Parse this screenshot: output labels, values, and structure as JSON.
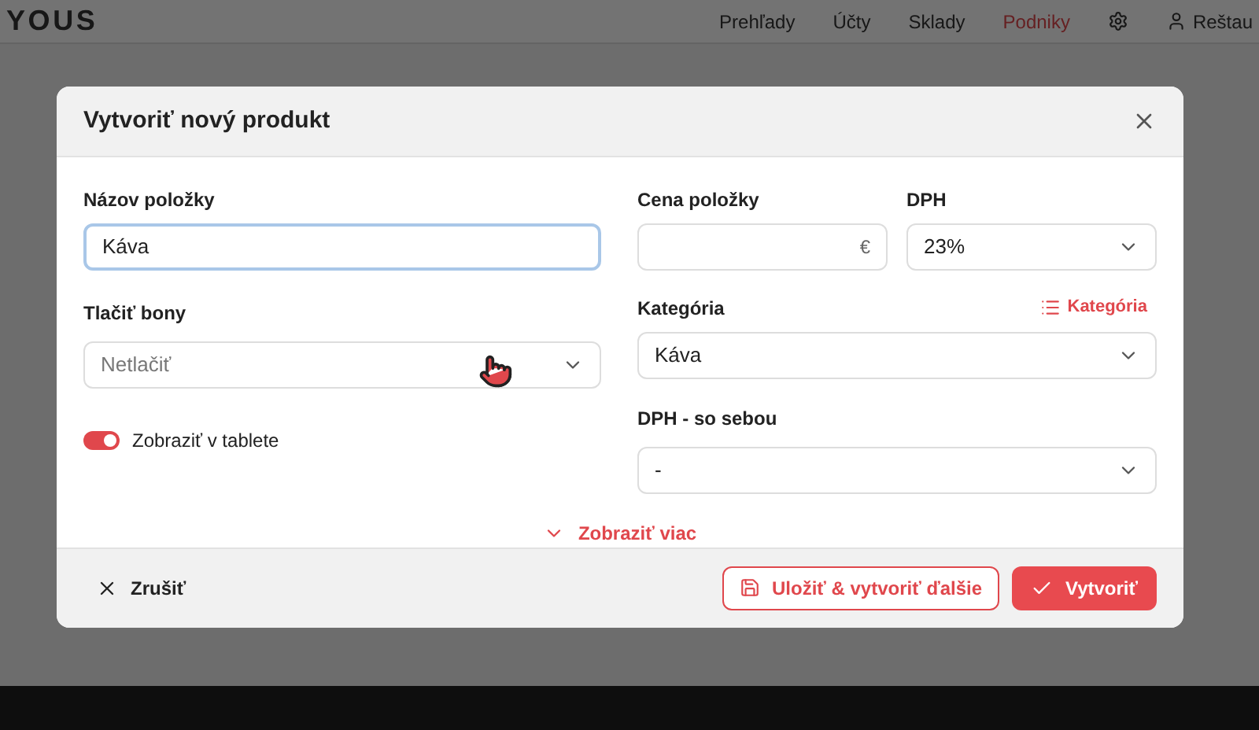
{
  "app": {
    "logo": "YOUS",
    "nav": [
      {
        "label": "Prehľady",
        "selected": false
      },
      {
        "label": "Účty",
        "selected": false
      },
      {
        "label": "Sklady",
        "selected": false
      },
      {
        "label": "Podniky",
        "selected": true
      }
    ],
    "user": "Reštau"
  },
  "dialog": {
    "title": "Vytvoriť nový produkt",
    "name_field": {
      "label": "Názov položky",
      "value": "Káva",
      "focused": true
    },
    "print_field": {
      "label": "Tlačiť bony",
      "placeholder": "Netlačiť"
    },
    "tablet_toggle": {
      "label": "Zobraziť v tablete",
      "on": true
    },
    "price_field": {
      "label": "Cena položky",
      "suffix": "€"
    },
    "vat_field": {
      "label": "DPH",
      "value": "23%"
    },
    "category_field": {
      "label": "Kategória",
      "link": "Kategória",
      "value": "Káva"
    },
    "vat_takeaway_field": {
      "label": "DPH - so sebou",
      "value": "-"
    },
    "more_link": "Zobraziť viac",
    "cancel": "Zrušiť",
    "save_next": "Uložiť & vytvoriť ďalšie",
    "create": "Vytvoriť"
  }
}
